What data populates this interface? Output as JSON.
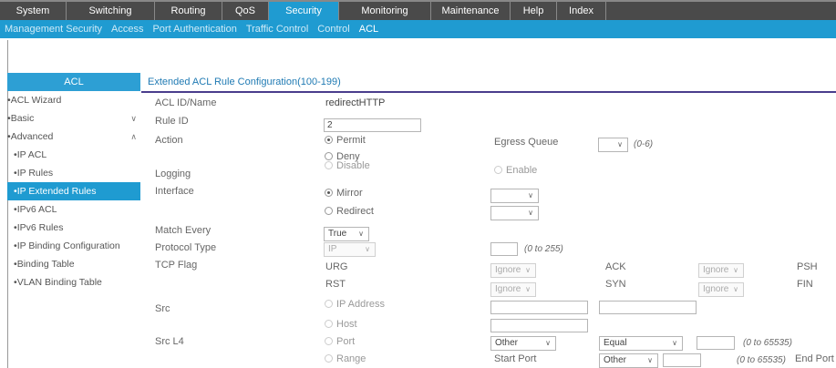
{
  "topnav": [
    "System",
    "Switching",
    "Routing",
    "QoS",
    "Security",
    "Monitoring",
    "Maintenance",
    "Help",
    "Index"
  ],
  "subnav": [
    "Management Security",
    "Access",
    "Port Authentication",
    "Traffic Control",
    "Control",
    "ACL"
  ],
  "sidebar": {
    "header": "ACL",
    "items": [
      {
        "label": "ACL Wizard"
      },
      {
        "label": "Basic",
        "chevron": "chevron-down"
      },
      {
        "label": "Advanced",
        "chevron": "chevron-up"
      },
      {
        "label": "IP ACL"
      },
      {
        "label": "IP Rules"
      },
      {
        "label": "IP Extended Rules",
        "selected": true
      },
      {
        "label": "IPv6 ACL"
      },
      {
        "label": "IPv6 Rules"
      },
      {
        "label": "IP Binding Configuration"
      },
      {
        "label": "Binding Table"
      },
      {
        "label": "VLAN Binding Table"
      }
    ]
  },
  "main": {
    "title": "Extended ACL Rule Configuration(100-199)",
    "acl_id_label": "ACL ID/Name",
    "acl_id_value": "redirectHTTP",
    "rule_id_label": "Rule ID",
    "rule_id_value": "2",
    "action_label": "Action",
    "permit": "Permit",
    "deny": "Deny",
    "egress_label": "Egress Queue",
    "egress_hint": "(0-6)",
    "logging_label": "Logging",
    "disable": "Disable",
    "enable": "Enable",
    "interface_label": "Interface",
    "mirror": "Mirror",
    "redirect": "Redirect",
    "match_every_label": "Match Every",
    "match_every_value": "True",
    "protocol_label": "Protocol Type",
    "protocol_value": "IP",
    "protocol_hint": "(0 to 255)",
    "tcp_flag_label": "TCP Flag",
    "urg": "URG",
    "rst": "RST",
    "ack": "ACK",
    "syn": "SYN",
    "psh": "PSH",
    "fin": "FIN",
    "ignore": "Ignore",
    "src_label": "Src",
    "ip_address": "IP Address",
    "host": "Host",
    "src_l4_label": "Src L4",
    "port": "Port",
    "range": "Range",
    "other": "Other",
    "equal": "Equal",
    "port_hint": "(0 to 65535)",
    "start_port": "Start Port",
    "end_port": "End Port"
  }
}
